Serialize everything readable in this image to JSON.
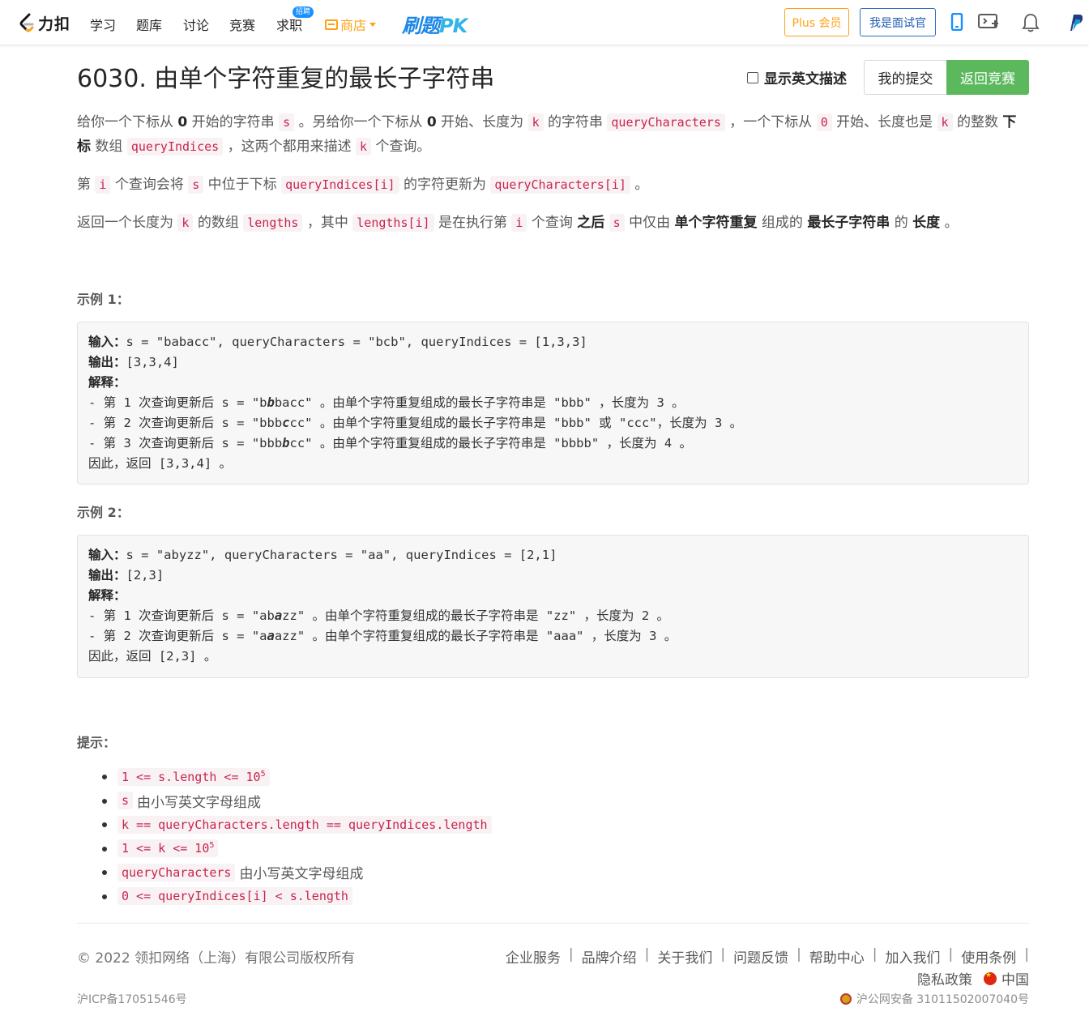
{
  "nav": {
    "logo_text": "力扣",
    "items": [
      "学习",
      "题库",
      "讨论",
      "竞赛",
      "求职"
    ],
    "job_badge": "招聘",
    "shop": "商店",
    "pk": "刷题",
    "pk_suffix": "PK",
    "plus": "Plus 会员",
    "interviewer": "我是面试官"
  },
  "problem": {
    "title": "6030. 由单个字符重复的最长子字符串",
    "show_english": "显示英文描述",
    "my_submissions": "我的提交",
    "back_to_contest": "返回竞赛"
  },
  "desc": {
    "p1_a": "给你一个下标从 ",
    "p1_b": "0",
    "p1_c": " 开始的字符串 ",
    "p1_s": "s",
    "p1_d": " 。另给你一个下标从 ",
    "p1_e": "0",
    "p1_f": " 开始、长度为 ",
    "p1_k": "k",
    "p1_g": " 的字符串 ",
    "p1_qc": "queryCharacters",
    "p1_h": " ，一个下标从 ",
    "p1_zero": "0",
    "p1_i": " 开始、长度也是 ",
    "p1_k2": "k",
    "p1_j": " 的整数 ",
    "p1_sub": "下标",
    "p1_l": " 数组 ",
    "p1_qi": "queryIndices",
    "p1_m": " ，这两个都用来描述 ",
    "p1_k3": "k",
    "p1_n": " 个查询。",
    "p2_a": "第 ",
    "p2_i": "i",
    "p2_b": " 个查询会将 ",
    "p2_s": "s",
    "p2_c": " 中位于下标 ",
    "p2_qi": "queryIndices[i]",
    "p2_d": " 的字符更新为 ",
    "p2_qc": "queryCharacters[i]",
    "p2_e": " 。",
    "p3_a": "返回一个长度为 ",
    "p3_k": "k",
    "p3_b": " 的数组 ",
    "p3_len": "lengths",
    "p3_c": " ，其中 ",
    "p3_leni": "lengths[i]",
    "p3_d": " 是在执行第 ",
    "p3_i": "i",
    "p3_e": " 个查询 ",
    "p3_after": "之后",
    "p3_s": "s",
    "p3_f": " 中仅由 ",
    "p3_single": "单个字符重复",
    "p3_g": " 组成的 ",
    "p3_longest": "最长子字符串",
    "p3_h": " 的 ",
    "p3_length": "长度",
    "p3_end": " 。"
  },
  "example1": {
    "heading": "示例 1：",
    "in_label": "输入：",
    "in_value": "s = \"babacc\", queryCharacters = \"bcb\", queryIndices = [1,3,3]",
    "out_label": "输出：",
    "out_value": "[3,3,4]",
    "exp_label": "解释：",
    "l1a": "- 第 1 次查询更新后 s = \"b",
    "l1b": "b",
    "l1c": "bacc\" 。由单个字符重复组成的最长子字符串是 \"bbb\" ，长度为 3 。",
    "l2a": "- 第 2 次查询更新后 s = \"bbb",
    "l2b": "c",
    "l2c": "cc\" 。由单个字符重复组成的最长子字符串是 \"bbb\" 或 \"ccc\"，长度为 3 。",
    "l3a": "- 第 3 次查询更新后 s = \"bbb",
    "l3b": "b",
    "l3c": "cc\" 。由单个字符重复组成的最长子字符串是 \"bbbb\" ，长度为 4 。",
    "conclusion": "因此，返回 [3,3,4] 。"
  },
  "example2": {
    "heading": "示例 2：",
    "in_label": "输入：",
    "in_value": "s = \"abyzz\", queryCharacters = \"aa\", queryIndices = [2,1]",
    "out_label": "输出：",
    "out_value": "[2,3]",
    "exp_label": "解释：",
    "l1a": "- 第 1 次查询更新后 s = \"ab",
    "l1b": "a",
    "l1c": "zz\" 。由单个字符重复组成的最长子字符串是 \"zz\" ，长度为 2 。",
    "l2a": "- 第 2 次查询更新后 s = \"a",
    "l2b": "a",
    "l2c": "azz\" 。由单个字符重复组成的最长子字符串是 \"aaa\" ，长度为 3 。",
    "conclusion": "因此，返回 [2,3] 。"
  },
  "hints": {
    "heading": "提示：",
    "h1_code": "1 <= s.length <= 10",
    "h1_sup": "5",
    "h2_code": "s",
    "h2_text": "由小写英文字母组成",
    "h3_code": "k == queryCharacters.length == queryIndices.length",
    "h4_code": "1 <= k <= 10",
    "h4_sup": "5",
    "h5_code": "queryCharacters",
    "h5_text": "由小写英文字母组成",
    "h6_code": "0 <= queryIndices[i] < s.length"
  },
  "footer": {
    "copyright": "© 2022 领扣网络（上海）有限公司版权所有",
    "icp": "沪ICP备17051546号",
    "links": [
      "企业服务",
      "品牌介绍",
      "关于我们",
      "问题反馈",
      "帮助中心",
      "加入我们",
      "使用条例"
    ],
    "privacy": "隐私政策",
    "region": "中国",
    "police": "沪公网安备 31011502007040号"
  },
  "colors": {
    "accent_orange": "#ffa116",
    "accent_green": "#5cb85c",
    "code_red": "#c7254e",
    "brand_blue": "#1e5db2"
  }
}
